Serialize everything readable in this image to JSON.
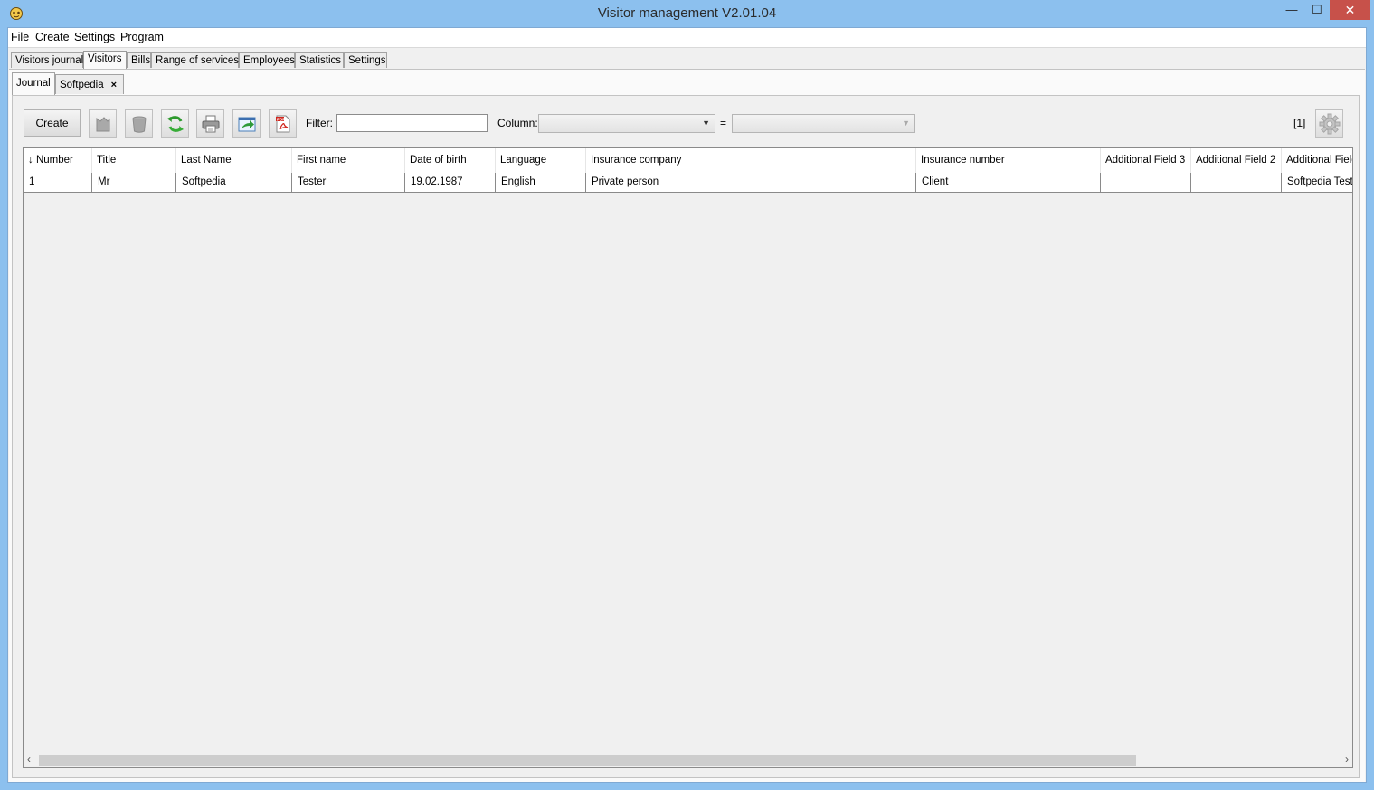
{
  "window": {
    "title": "Visitor management V2.01.04",
    "controls": {
      "minimize": "—",
      "maximize": "☐",
      "close": "✕"
    }
  },
  "menu": [
    "File",
    "Create",
    "Settings",
    "Program"
  ],
  "main_tabs": [
    "Visitors journal",
    "Visitors",
    "Bills",
    "Range of services",
    "Employees",
    "Statistics",
    "Settings"
  ],
  "main_tabs_active": "Visitors",
  "sub_tabs": [
    "Journal",
    "Softpedia"
  ],
  "sub_tab_close": "×",
  "toolbar": {
    "create_label": "Create",
    "icons": [
      "delete-broom-icon",
      "trash-bin-icon",
      "refresh-icon",
      "print-icon",
      "export-icon",
      "pdf-icon",
      "settings-gear-icon"
    ],
    "filter_label": "Filter:",
    "filter_value": "",
    "column_label": "Column:",
    "column_value": "",
    "equals_sign": "=",
    "value_select": "",
    "record_count": "[1]"
  },
  "table": {
    "columns": [
      "↓ Number",
      "Title",
      "Last Name",
      "First name",
      "Date of birth",
      "Language",
      "Insurance company",
      "Insurance number",
      "Additional Field 3",
      "Additional Field 2",
      "Additional Field"
    ],
    "rows": [
      [
        "1",
        "Mr",
        "Softpedia",
        "Tester",
        "19.02.1987",
        "English",
        "Private person",
        "Client",
        "",
        "",
        "Softpedia Test"
      ]
    ]
  },
  "scrollbar": {
    "left_arrow": "‹",
    "right_arrow": "›"
  },
  "colors": {
    "titlebar": "#8cc0ee",
    "close_button": "#c7514a",
    "panel": "#f0f0f0"
  }
}
